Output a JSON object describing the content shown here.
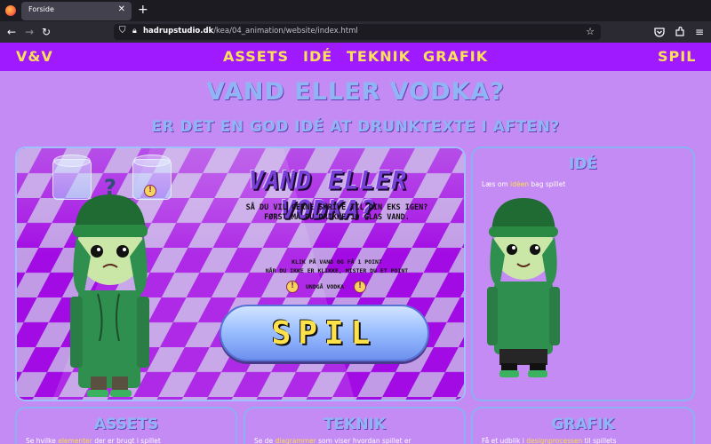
{
  "browser": {
    "tab_title": "Forside",
    "tab_close": "✕",
    "new_tab": "+",
    "url_domain": "hadrupstudio.dk",
    "url_path": "/kea/04_animation/website/index.html"
  },
  "site_nav": {
    "logo": "V&V",
    "links": [
      "ASSETS",
      "IDÉ",
      "TEKNIK",
      "GRAFIK"
    ],
    "play": "SPIL",
    "text_color": "#ffe05a",
    "background": "#9f1aff"
  },
  "hero": {
    "title": "VAND ELLER VODKA?",
    "subtitle": "ER DET EN GOD IDÉ AT DRUNKTEXTE I AFTEN?"
  },
  "game": {
    "title": "VAND ELLER VODKA?",
    "line1": "SÅ DU VIL GERNE SKRIVE TIL DIN EKS IGEN?",
    "line2": "FØRST MÅ DU DRIKKE 10 GLAS VAND.",
    "line3": "KLIK PÅ VAND OG FÅ 1 POINT",
    "line4": "NÅR DU IKKE ER KLIKKE, MISTER DU ET POINT",
    "warning": "UNDGÅ VODKA",
    "warning_symbol": "!",
    "question_mark": "?",
    "play_button": "SPIL"
  },
  "idea_card": {
    "title": "IDÉ",
    "text_before": "Læs om ",
    "link": "idéen",
    "text_after": " bag spillet"
  },
  "bottom_cards": [
    {
      "title": "ASSETS",
      "text_before": "Se hvilke ",
      "link": "elementer",
      "text_after": " der er brugt i spillet"
    },
    {
      "title": "TEKNIK",
      "text_before": "Se de ",
      "link": "diagrammer",
      "text_after": " som viser hvordan spillet er"
    },
    {
      "title": "GRAFIK",
      "text_before": "Få et udblik i ",
      "link": "designprocessen",
      "text_after": " til spillets"
    }
  ]
}
